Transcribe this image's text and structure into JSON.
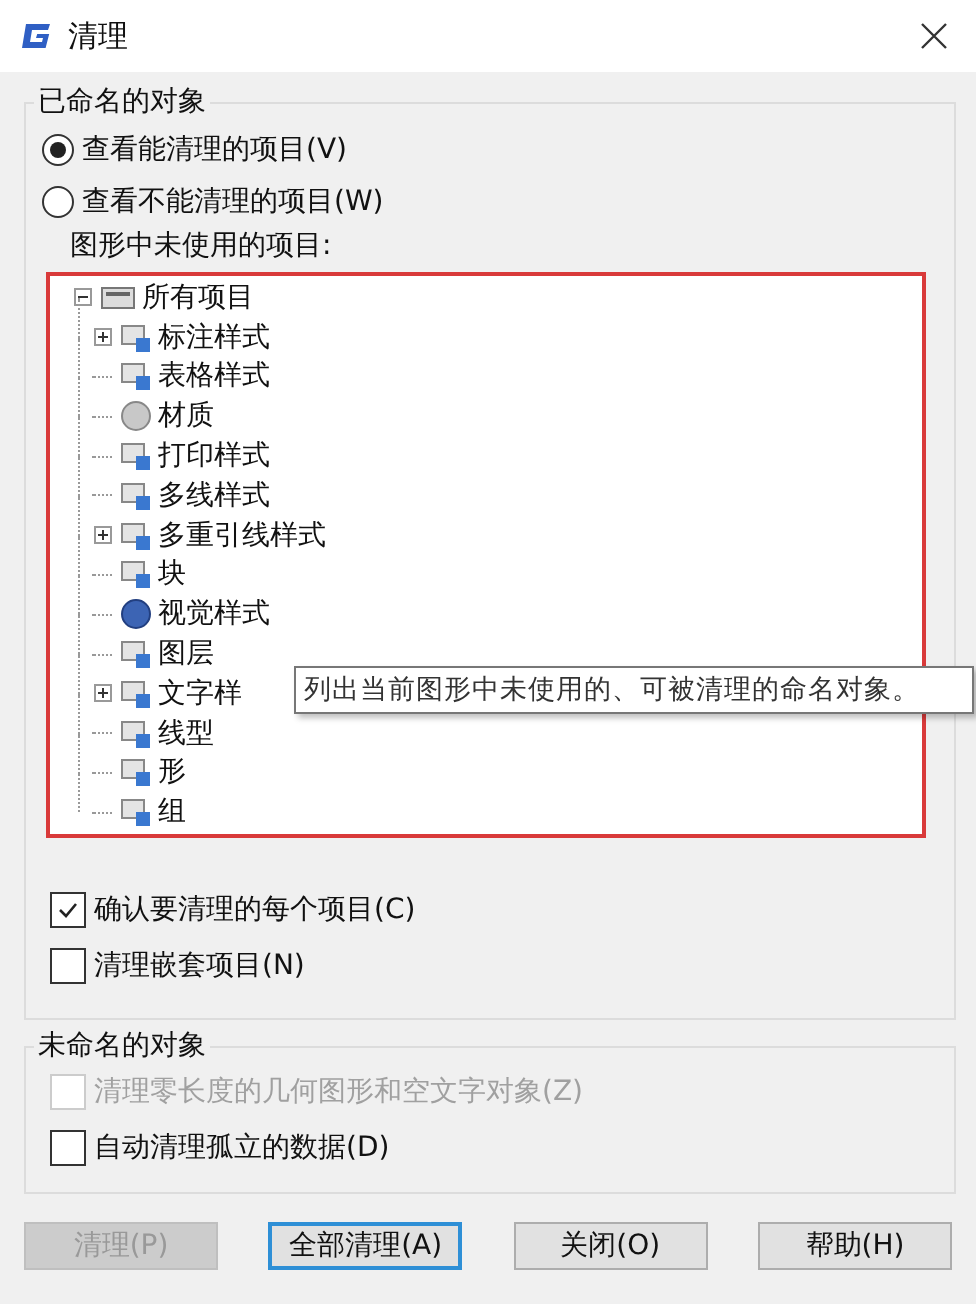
{
  "window": {
    "title": "清理"
  },
  "named_objects": {
    "label": "已命名的对象",
    "radios": [
      {
        "label": "查看能清理的项目(V)",
        "selected": true
      },
      {
        "label": "查看不能清理的项目(W)",
        "selected": false
      }
    ],
    "tree_label": "图形中未使用的项目:",
    "tree": {
      "label": "所有项目",
      "expanded": true,
      "children": [
        {
          "label": "标注样式",
          "expanded": false
        },
        {
          "label": "表格样式"
        },
        {
          "label": "材质"
        },
        {
          "label": "打印样式"
        },
        {
          "label": "多线样式"
        },
        {
          "label": "多重引线样式",
          "expanded": false
        },
        {
          "label": "块"
        },
        {
          "label": "视觉样式"
        },
        {
          "label": "图层"
        },
        {
          "label": "文字样",
          "expanded": false
        },
        {
          "label": "线型"
        },
        {
          "label": "形"
        },
        {
          "label": "组"
        }
      ]
    },
    "tooltip": "列出当前图形中未使用的、可被清理的命名对象。",
    "checkboxes": [
      {
        "label": "确认要清理的每个项目(C)",
        "checked": true,
        "disabled": false
      },
      {
        "label": "清理嵌套项目(N)",
        "checked": false,
        "disabled": false
      }
    ]
  },
  "unnamed_objects": {
    "label": "未命名的对象",
    "checkboxes": [
      {
        "label": "清理零长度的几何图形和空文字对象(Z)",
        "checked": false,
        "disabled": true
      },
      {
        "label": "自动清理孤立的数据(D)",
        "checked": false,
        "disabled": false
      }
    ]
  },
  "buttons": [
    {
      "label": "清理(P)",
      "disabled": true,
      "focused": false
    },
    {
      "label": "全部清理(A)",
      "disabled": false,
      "focused": true
    },
    {
      "label": "关闭(O)",
      "disabled": false,
      "focused": false
    },
    {
      "label": "帮助(H)",
      "disabled": false,
      "focused": false
    }
  ]
}
